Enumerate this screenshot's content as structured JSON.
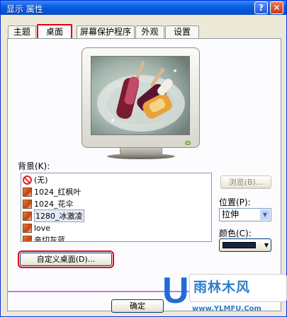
{
  "window": {
    "title": "显示 属性",
    "help_label": "?",
    "close_label": "✕"
  },
  "tabs": [
    {
      "label": "主题"
    },
    {
      "label": "桌面",
      "active": true
    },
    {
      "label": "屏幕保护程序"
    },
    {
      "label": "外观"
    },
    {
      "label": "设置"
    }
  ],
  "background": {
    "label": "背景(K):",
    "items": [
      {
        "label": "(无)",
        "icon": "no-entry-icon"
      },
      {
        "label": "1024_红枫叶",
        "icon": "image-file-icon"
      },
      {
        "label": "1024_花伞",
        "icon": "image-file-icon"
      },
      {
        "label": "1280_冰激凌",
        "icon": "image-file-icon",
        "selected": true
      },
      {
        "label": "love",
        "icon": "image-file-icon"
      },
      {
        "label": "亲切灰蓝",
        "icon": "image-file-icon"
      }
    ],
    "browse_label": "浏览(B)..."
  },
  "position": {
    "label": "位置(P):",
    "value": "拉伸"
  },
  "color": {
    "label": "颜色(C):",
    "value": "#1a2340"
  },
  "customize_label": "自定义桌面(D)...",
  "ok_label": "确定",
  "watermark": {
    "letter": "U",
    "text": "雨林木风",
    "url": "www.YLMFU.Com"
  },
  "colors": {
    "titlebar": "#0a5fe4",
    "highlight_box": "#e4000f",
    "accent_line": "#c27ce6"
  }
}
